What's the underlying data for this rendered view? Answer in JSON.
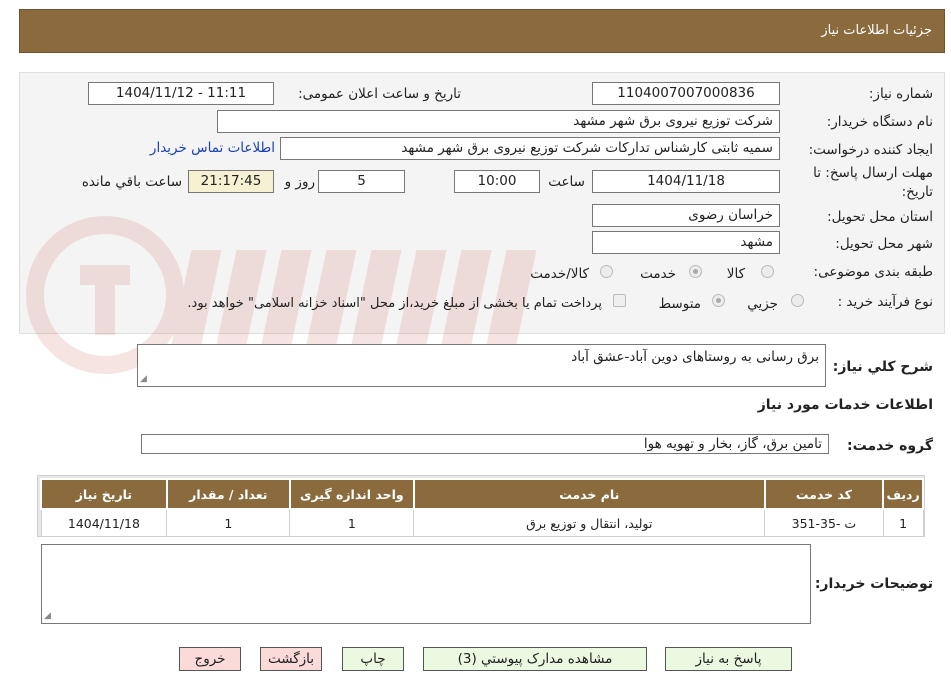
{
  "header": {
    "title": "جزئیات اطلاعات نیاز"
  },
  "form": {
    "need_number": {
      "label": "شماره نیاز:",
      "value": "1104007007000836"
    },
    "announce": {
      "label": "تاریخ و ساعت اعلان عمومی:",
      "value": "1404/11/12 - 11:11"
    },
    "buyer_org": {
      "label": "نام دستگاه خریدار:",
      "value": "شرکت توزیع نیروی برق شهر مشهد"
    },
    "requester": {
      "label": "ایجاد کننده درخواست:",
      "value": "سمیه ثابتی کارشناس تدارکات شرکت توزیع نیروی برق شهر مشهد"
    },
    "contact_link": "اطلاعات تماس خریدار",
    "deadline": {
      "label_line1": "مهلت ارسال پاسخ: تا",
      "label_line2": "تاریخ:",
      "date": "1404/11/18",
      "time_label": "ساعت",
      "time": "10:00",
      "days": "5",
      "days_label": "روز و",
      "remaining": "21:17:45",
      "remaining_label": "ساعت باقي مانده"
    },
    "province": {
      "label": "استان محل تحویل:",
      "value": "خراسان رضوی"
    },
    "city": {
      "label": "شهر محل تحویل:",
      "value": "مشهد"
    },
    "category": {
      "label": "طبقه بندی موضوعی:",
      "options": [
        "کالا",
        "خدمت",
        "کالا/خدمت"
      ],
      "selected": "خدمت"
    },
    "process": {
      "label": "نوع فرآیند خرید :",
      "options": [
        "جزیي",
        "متوسط"
      ],
      "selected": "متوسط",
      "note": "پرداخت تمام یا بخشی از مبلغ خرید،از محل \"اسناد خزانه اسلامی\" خواهد بود."
    }
  },
  "description": {
    "label": "شرح كلي نياز:",
    "value": "برق رسانی به روستاهای دوین آباد-عشق آباد"
  },
  "services": {
    "title": "اطلاعات خدمات مورد نياز",
    "group_label": "گروه خدمت:",
    "group_value": "تامین برق، گاز، بخار و تهویه هوا",
    "columns": [
      "رديف",
      "كد خدمت",
      "نام خدمت",
      "واحد اندازه گيری",
      "تعداد / مقدار",
      "تاريخ نياز"
    ],
    "rows": [
      [
        "1",
        "ت -35-351",
        "تولید، انتقال و توزیع برق",
        "1",
        "1",
        "1404/11/18"
      ]
    ]
  },
  "buyer_notes": {
    "label": "توضيحات خريدار:",
    "value": ""
  },
  "buttons": {
    "reply": "پاسخ به نياز",
    "attachments": "مشاهده مدارک پيوستي (3)",
    "print": "چاپ",
    "back": "بازگشت",
    "exit": "خروج"
  },
  "colors": {
    "header_bg": "#8b6b3e",
    "button_bg": "#eaf9df",
    "button_pink": "#fbdada",
    "time_bg": "#f6f1d2"
  }
}
